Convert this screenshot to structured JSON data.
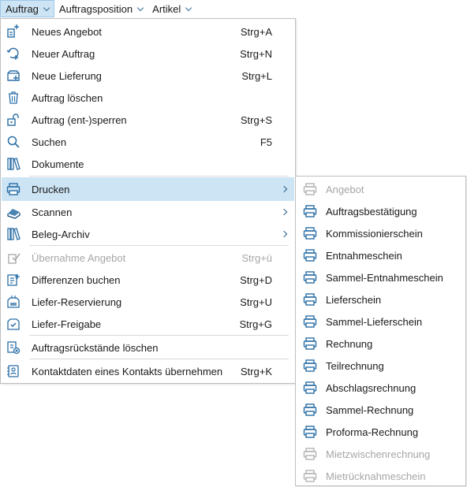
{
  "menubar": {
    "items": [
      {
        "label": "Auftrag"
      },
      {
        "label": "Auftragsposition"
      },
      {
        "label": "Artikel"
      }
    ]
  },
  "menu": {
    "items": [
      {
        "label": "Neues Angebot",
        "shortcut": "Strg+A",
        "icon": "new-offer-icon"
      },
      {
        "label": "Neuer Auftrag",
        "shortcut": "Strg+N",
        "icon": "new-order-icon"
      },
      {
        "label": "Neue Lieferung",
        "shortcut": "Strg+L",
        "icon": "new-delivery-icon"
      },
      {
        "label": "Auftrag löschen",
        "shortcut": "",
        "icon": "trash-icon"
      },
      {
        "label": "Auftrag (ent-)sperren",
        "shortcut": "Strg+S",
        "icon": "lock-icon"
      },
      {
        "label": "Suchen",
        "shortcut": "F5",
        "icon": "search-icon"
      },
      {
        "label": "Dokumente",
        "shortcut": "",
        "icon": "books-icon"
      },
      {
        "label": "Drucken",
        "shortcut": "",
        "icon": "printer-icon"
      },
      {
        "label": "Scannen",
        "shortcut": "",
        "icon": "scanner-icon"
      },
      {
        "label": "Beleg-Archiv",
        "shortcut": "",
        "icon": "archive-icon"
      },
      {
        "label": "Übernahme Angebot",
        "shortcut": "Strg+ü",
        "icon": "take-over-icon"
      },
      {
        "label": "Differenzen buchen",
        "shortcut": "Strg+D",
        "icon": "differences-icon"
      },
      {
        "label": "Liefer-Reservierung",
        "shortcut": "Strg+U",
        "icon": "reservation-icon"
      },
      {
        "label": "Liefer-Freigabe",
        "shortcut": "Strg+G",
        "icon": "release-icon"
      },
      {
        "label": "Auftragsrückstände löschen",
        "shortcut": "",
        "icon": "backlog-delete-icon"
      },
      {
        "label": "Kontaktdaten eines Kontakts übernehmen",
        "shortcut": "Strg+K",
        "icon": "contact-icon"
      }
    ]
  },
  "submenu": {
    "items": [
      {
        "label": "Angebot"
      },
      {
        "label": "Auftragsbestätigung"
      },
      {
        "label": "Kommissionierschein"
      },
      {
        "label": "Entnahmeschein"
      },
      {
        "label": "Sammel-Entnahmeschein"
      },
      {
        "label": "Lieferschein"
      },
      {
        "label": "Sammel-Lieferschein"
      },
      {
        "label": "Rechnung"
      },
      {
        "label": "Teilrechnung"
      },
      {
        "label": "Abschlagsrechnung"
      },
      {
        "label": "Sammel-Rechnung"
      },
      {
        "label": "Proforma-Rechnung"
      },
      {
        "label": "Mietzwischenrechnung"
      },
      {
        "label": "Mietrücknahmeschein"
      }
    ]
  },
  "colors": {
    "highlight": "#cce4f4",
    "icon_blue": "#2a6ea6",
    "disabled": "#a6a6a6"
  }
}
